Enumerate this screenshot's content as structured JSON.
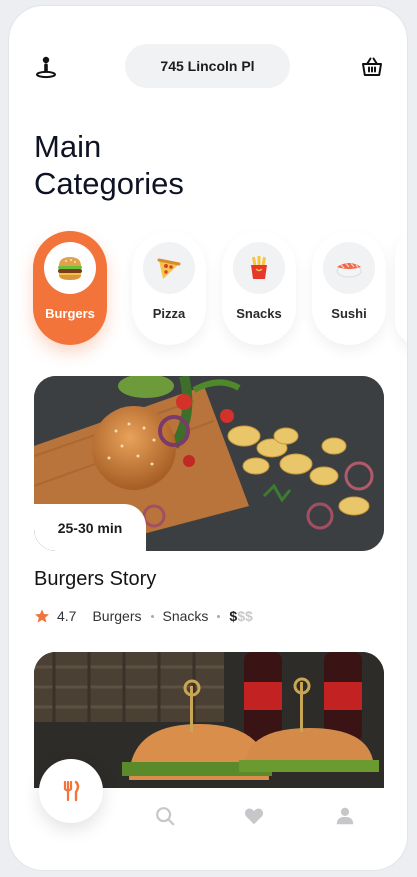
{
  "header": {
    "location": "745 Lincoln Pl",
    "left_icon": "location-person-icon",
    "right_icon": "basket-icon"
  },
  "title": {
    "line1": "Main",
    "line2": "Categories"
  },
  "categories": [
    {
      "label": "Burgers",
      "icon": "burger-icon",
      "active": true
    },
    {
      "label": "Pizza",
      "icon": "pizza-icon",
      "active": false
    },
    {
      "label": "Snacks",
      "icon": "fries-icon",
      "active": false
    },
    {
      "label": "Sushi",
      "icon": "sushi-icon",
      "active": false
    }
  ],
  "featured": {
    "delivery_time": "25-30 min",
    "name": "Burgers Story",
    "rating": "4.7",
    "tags": [
      "Burgers",
      "Snacks"
    ],
    "price_active": "$",
    "price_inactive": "$$"
  },
  "tabbar": {
    "items": [
      "restaurants-icon",
      "search-icon",
      "heart-icon",
      "profile-icon"
    ]
  },
  "colors": {
    "accent": "#f2743a",
    "background": "#ffffff",
    "text": "#0f1222"
  }
}
